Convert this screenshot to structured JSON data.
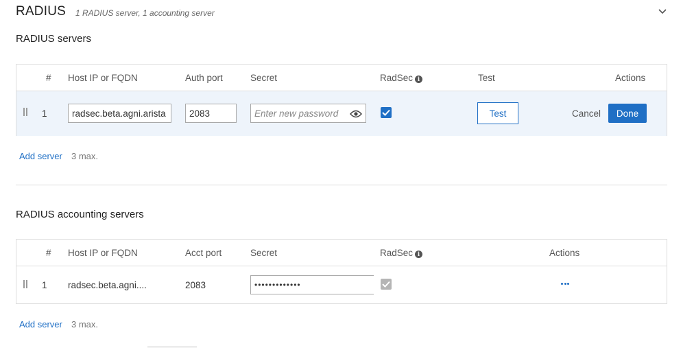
{
  "section": {
    "title": "RADIUS",
    "subtitle": "1 RADIUS server, 1 accounting server"
  },
  "radius_servers": {
    "heading": "RADIUS servers",
    "columns": {
      "num": "#",
      "host": "Host IP or FQDN",
      "port": "Auth port",
      "secret": "Secret",
      "radsec": "RadSec",
      "test": "Test",
      "actions": "Actions"
    },
    "row": {
      "index": "1",
      "host_value": "radsec.beta.agni.arista",
      "port_value": "2083",
      "secret_placeholder": "Enter new password",
      "radsec_checked": true,
      "test_label": "Test",
      "cancel_label": "Cancel",
      "done_label": "Done"
    },
    "add_label": "Add server",
    "max_note": "3 max."
  },
  "accounting_servers": {
    "heading": "RADIUS accounting servers",
    "columns": {
      "num": "#",
      "host": "Host IP or FQDN",
      "port": "Acct port",
      "secret": "Secret",
      "radsec": "RadSec",
      "actions": "Actions"
    },
    "row": {
      "index": "1",
      "host": "radsec.beta.agni....",
      "port": "2083",
      "secret_masked": "•••••••••••••",
      "radsec_checked": true
    },
    "add_label": "Add server",
    "max_note": "3 max."
  },
  "colors": {
    "accent": "#1f6fc5",
    "editing_row_bg": "#eef4fb",
    "border": "#dcdcdc"
  },
  "icons": [
    "chevron-down-icon",
    "info-icon",
    "eye-icon",
    "check-icon",
    "drag-handle-icon",
    "more-horizontal-icon"
  ]
}
